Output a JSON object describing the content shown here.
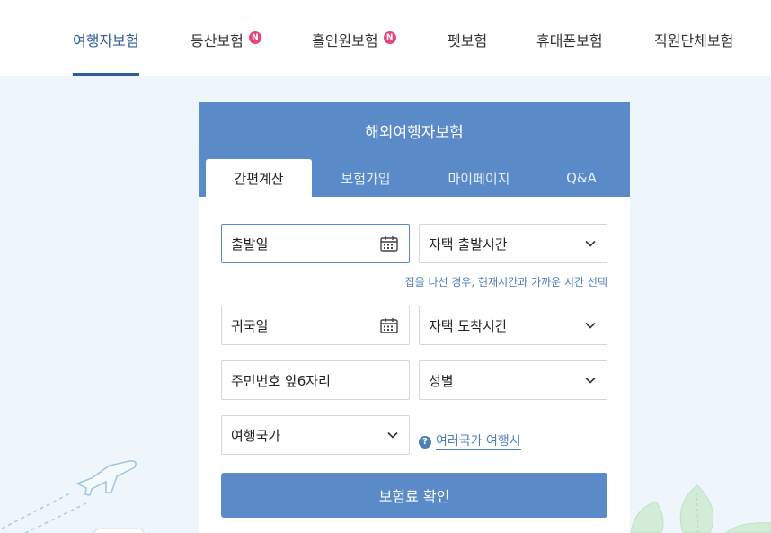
{
  "nav": {
    "tabs": [
      {
        "label": "여행자보험"
      },
      {
        "label": "등산보험",
        "badge": "N"
      },
      {
        "label": "홀인원보험",
        "badge": "N"
      },
      {
        "label": "펫보험"
      },
      {
        "label": "휴대폰보험"
      },
      {
        "label": "직원단체보험"
      }
    ],
    "active_tab": "여행자보험"
  },
  "card": {
    "title": "해외여행자보험",
    "subtabs": [
      "간편계산",
      "보험가입",
      "마이페이지",
      "Q&A"
    ],
    "active_subtab": "간편계산"
  },
  "form": {
    "departure_date_placeholder": "출발일",
    "departure_time_select": "자택 출발시간",
    "departure_helper": "집을 나선 경우, 현재시간과 가까운 시간 선택",
    "return_date_placeholder": "귀국일",
    "arrival_time_select": "자택 도착시간",
    "resident_number_placeholder": "주민번호 앞6자리",
    "gender_select": "성별",
    "country_select": "여행국가",
    "multi_country_link": "여러국가 여행시",
    "help_icon": "?",
    "submit_label": "보험료 확인"
  },
  "colors": {
    "accent": "#5b8ac8",
    "nav_active": "#2f5d9a",
    "badge": "#e8457a",
    "background": "#eef6fb"
  },
  "icons": [
    "calendar-icon",
    "chevron-down-icon",
    "help-icon",
    "new-badge",
    "airplane-icon",
    "leaf-icon"
  ]
}
